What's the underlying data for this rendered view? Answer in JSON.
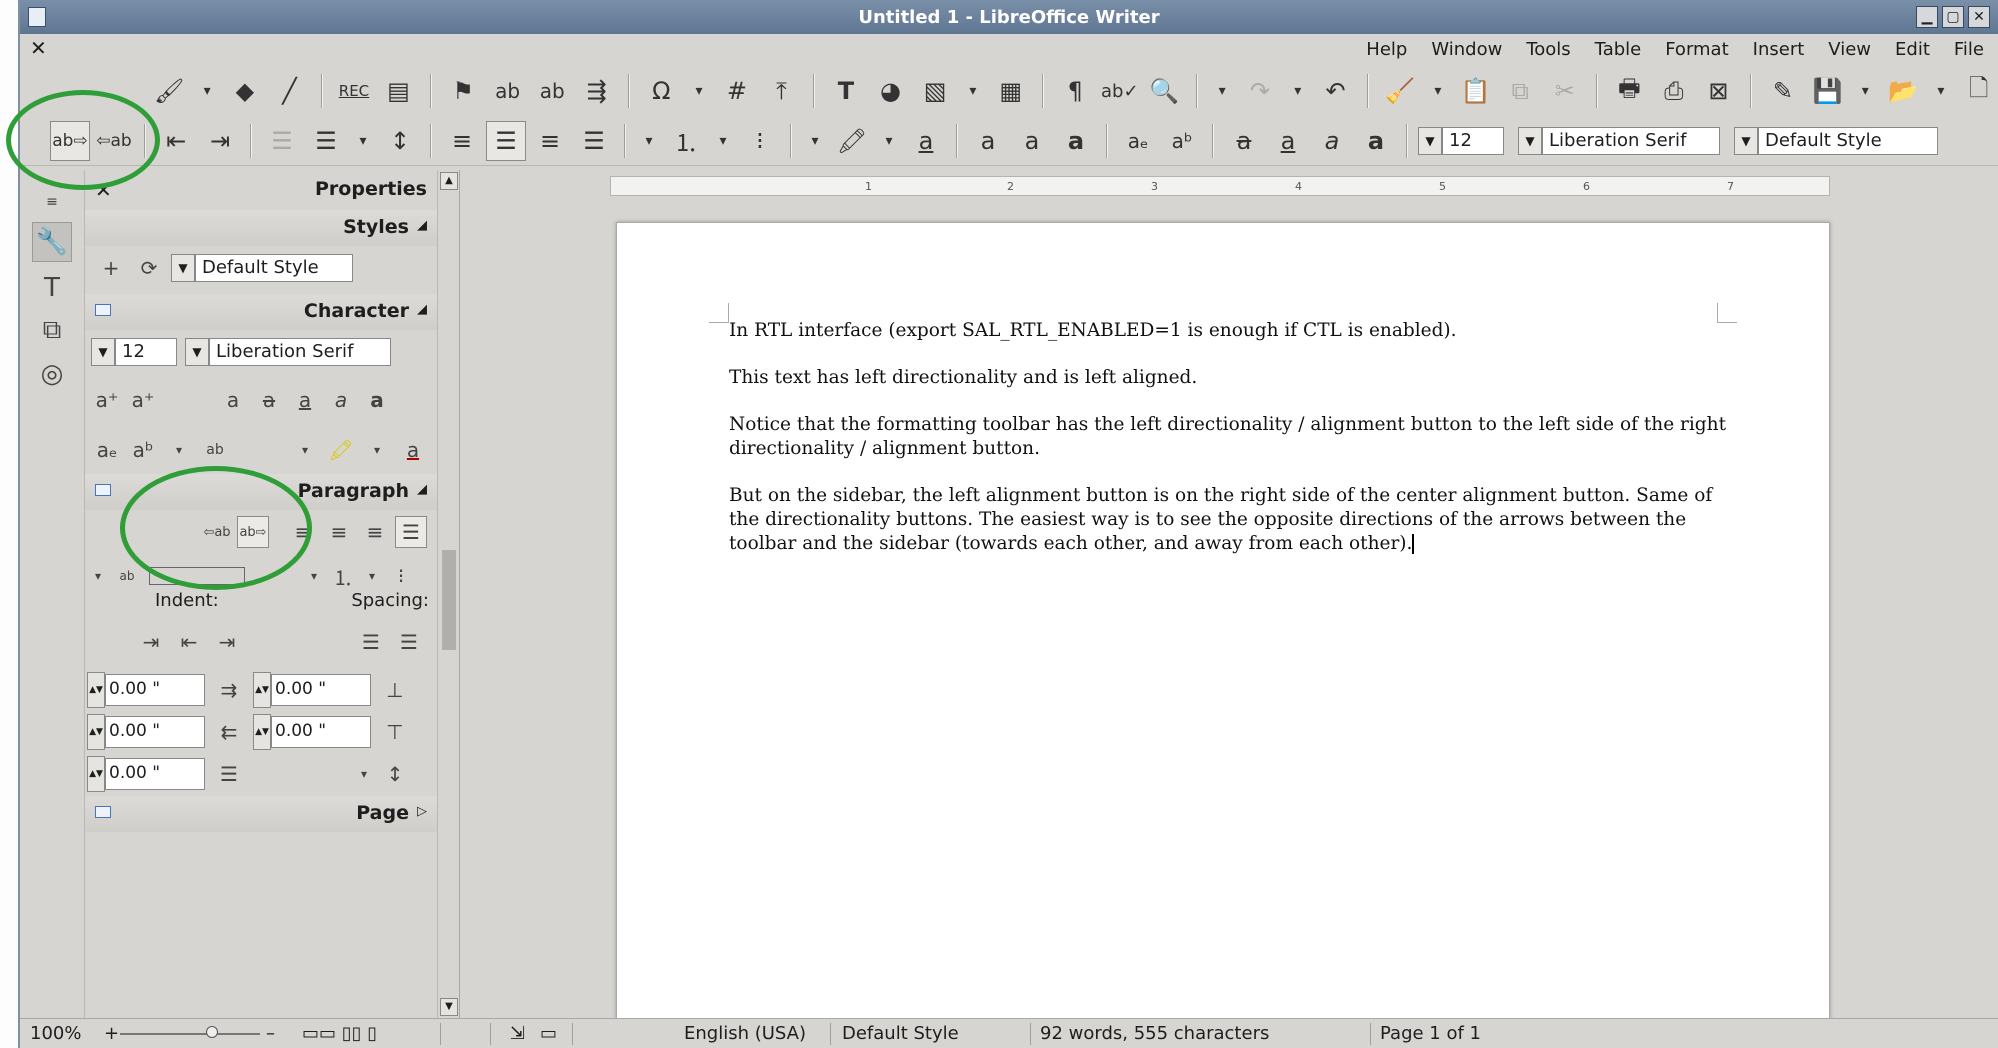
{
  "window": {
    "title": "Untitled 1 - LibreOffice Writer"
  },
  "menu": [
    "Help",
    "Window",
    "Tools",
    "Table",
    "Format",
    "Insert",
    "View",
    "Edit",
    "File"
  ],
  "formatting": {
    "font_size": "12",
    "font_name": "Liberation Serif",
    "para_style": "Default Style"
  },
  "sidebar": {
    "title": "Properties",
    "decks": {
      "styles": "Styles",
      "character": "Character",
      "paragraph": "Paragraph",
      "page": "Page"
    },
    "style_value": "Default Style",
    "char_size": "12",
    "char_font": "Liberation Serif",
    "indent_label": "Indent:",
    "spacing_label": "Spacing:",
    "fields": [
      "0.00 \"",
      "0.00 \"",
      "0.00 \"",
      "0.00 \"",
      "0.00 \""
    ]
  },
  "document": {
    "paragraphs": [
      "In RTL interface (export SAL_RTL_ENABLED=1 is enough if CTL is enabled).",
      "This text has left directionality and is left aligned.",
      "Notice that the formatting toolbar has the left directionality / alignment button to the left side of the right directionality / alignment button.",
      "But on the sidebar, the left alignment button is on the right side of the center alignment button. Same of the directionality buttons. The easiest way is to see the opposite directions of the arrows between the toolbar and the sidebar (towards each other, and away from each other)."
    ]
  },
  "ruler_numbers": [
    "1",
    "2",
    "3",
    "4",
    "5",
    "6",
    "7"
  ],
  "status": {
    "zoom": "100%",
    "language": "English (USA)",
    "page_style": "Default Style",
    "word_count": "92 words, 555 characters",
    "page": "Page 1 of 1"
  },
  "colors": {
    "annotation": "#2f9e38",
    "titlebar": "#6a809c"
  }
}
